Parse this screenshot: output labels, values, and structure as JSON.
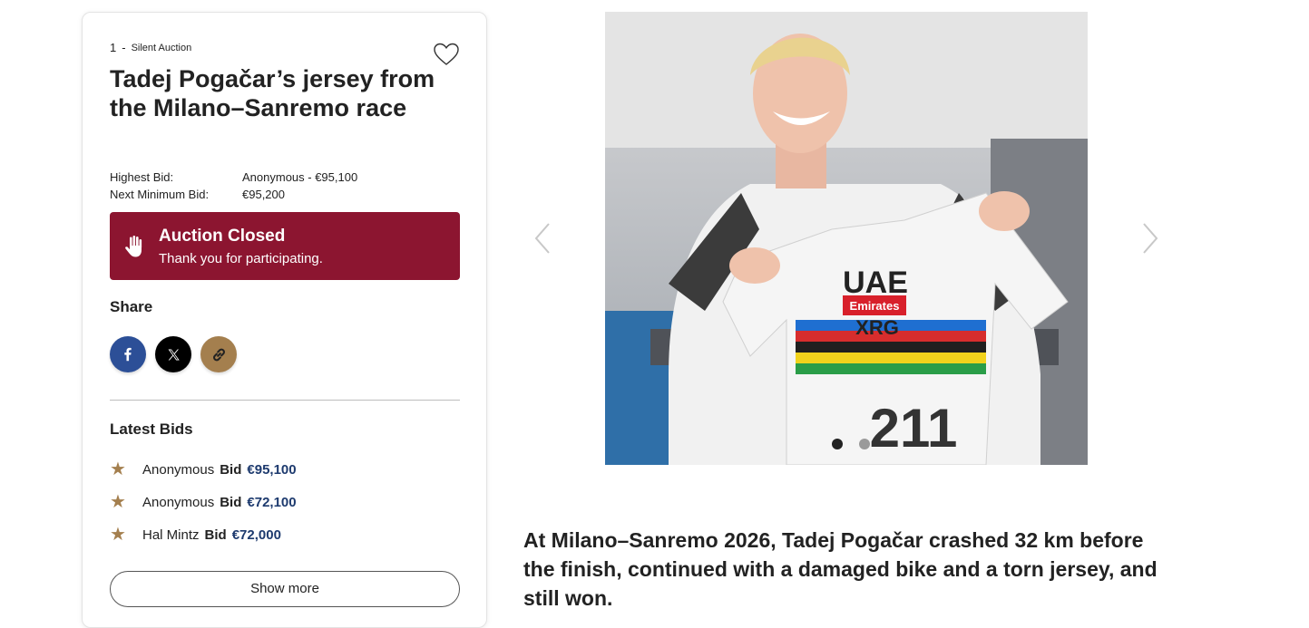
{
  "lot": {
    "number": "1",
    "separator": "-",
    "type": "Silent Auction"
  },
  "title": "Tadej Pogačar’s jersey from the Milano–Sanremo race",
  "bid_info": {
    "highest_label": "Highest Bid:",
    "highest_value": "Anonymous - €95,100",
    "next_label": "Next Minimum Bid:",
    "next_value": "€95,200"
  },
  "status": {
    "heading": "Auction Closed",
    "message": "Thank you for participating.",
    "color": "#8c1530"
  },
  "share": {
    "heading": "Share",
    "buttons": [
      {
        "icon": "facebook-icon",
        "color": "#2c4f97"
      },
      {
        "icon": "x-icon",
        "color": "#000000"
      },
      {
        "icon": "link-icon",
        "color": "#a47f4e"
      }
    ]
  },
  "latest_bids": {
    "heading": "Latest Bids",
    "bid_word": "Bid",
    "items": [
      {
        "name": "Anonymous",
        "amount": "€95,100"
      },
      {
        "name": "Anonymous",
        "amount": "€72,100"
      },
      {
        "name": "Hal Mintz",
        "amount": "€72,000"
      }
    ],
    "show_more_label": "Show more"
  },
  "gallery": {
    "image_count": 2,
    "active_index": 1,
    "jersey_text": {
      "team": "UAE",
      "sponsor": "Emirates",
      "brand": "XRG",
      "number": "211"
    }
  },
  "description": "At Milano–Sanremo 2026, Tadej Pogačar crashed 32 km before the finish, continued with a damaged bike and a torn jersey, and still won."
}
